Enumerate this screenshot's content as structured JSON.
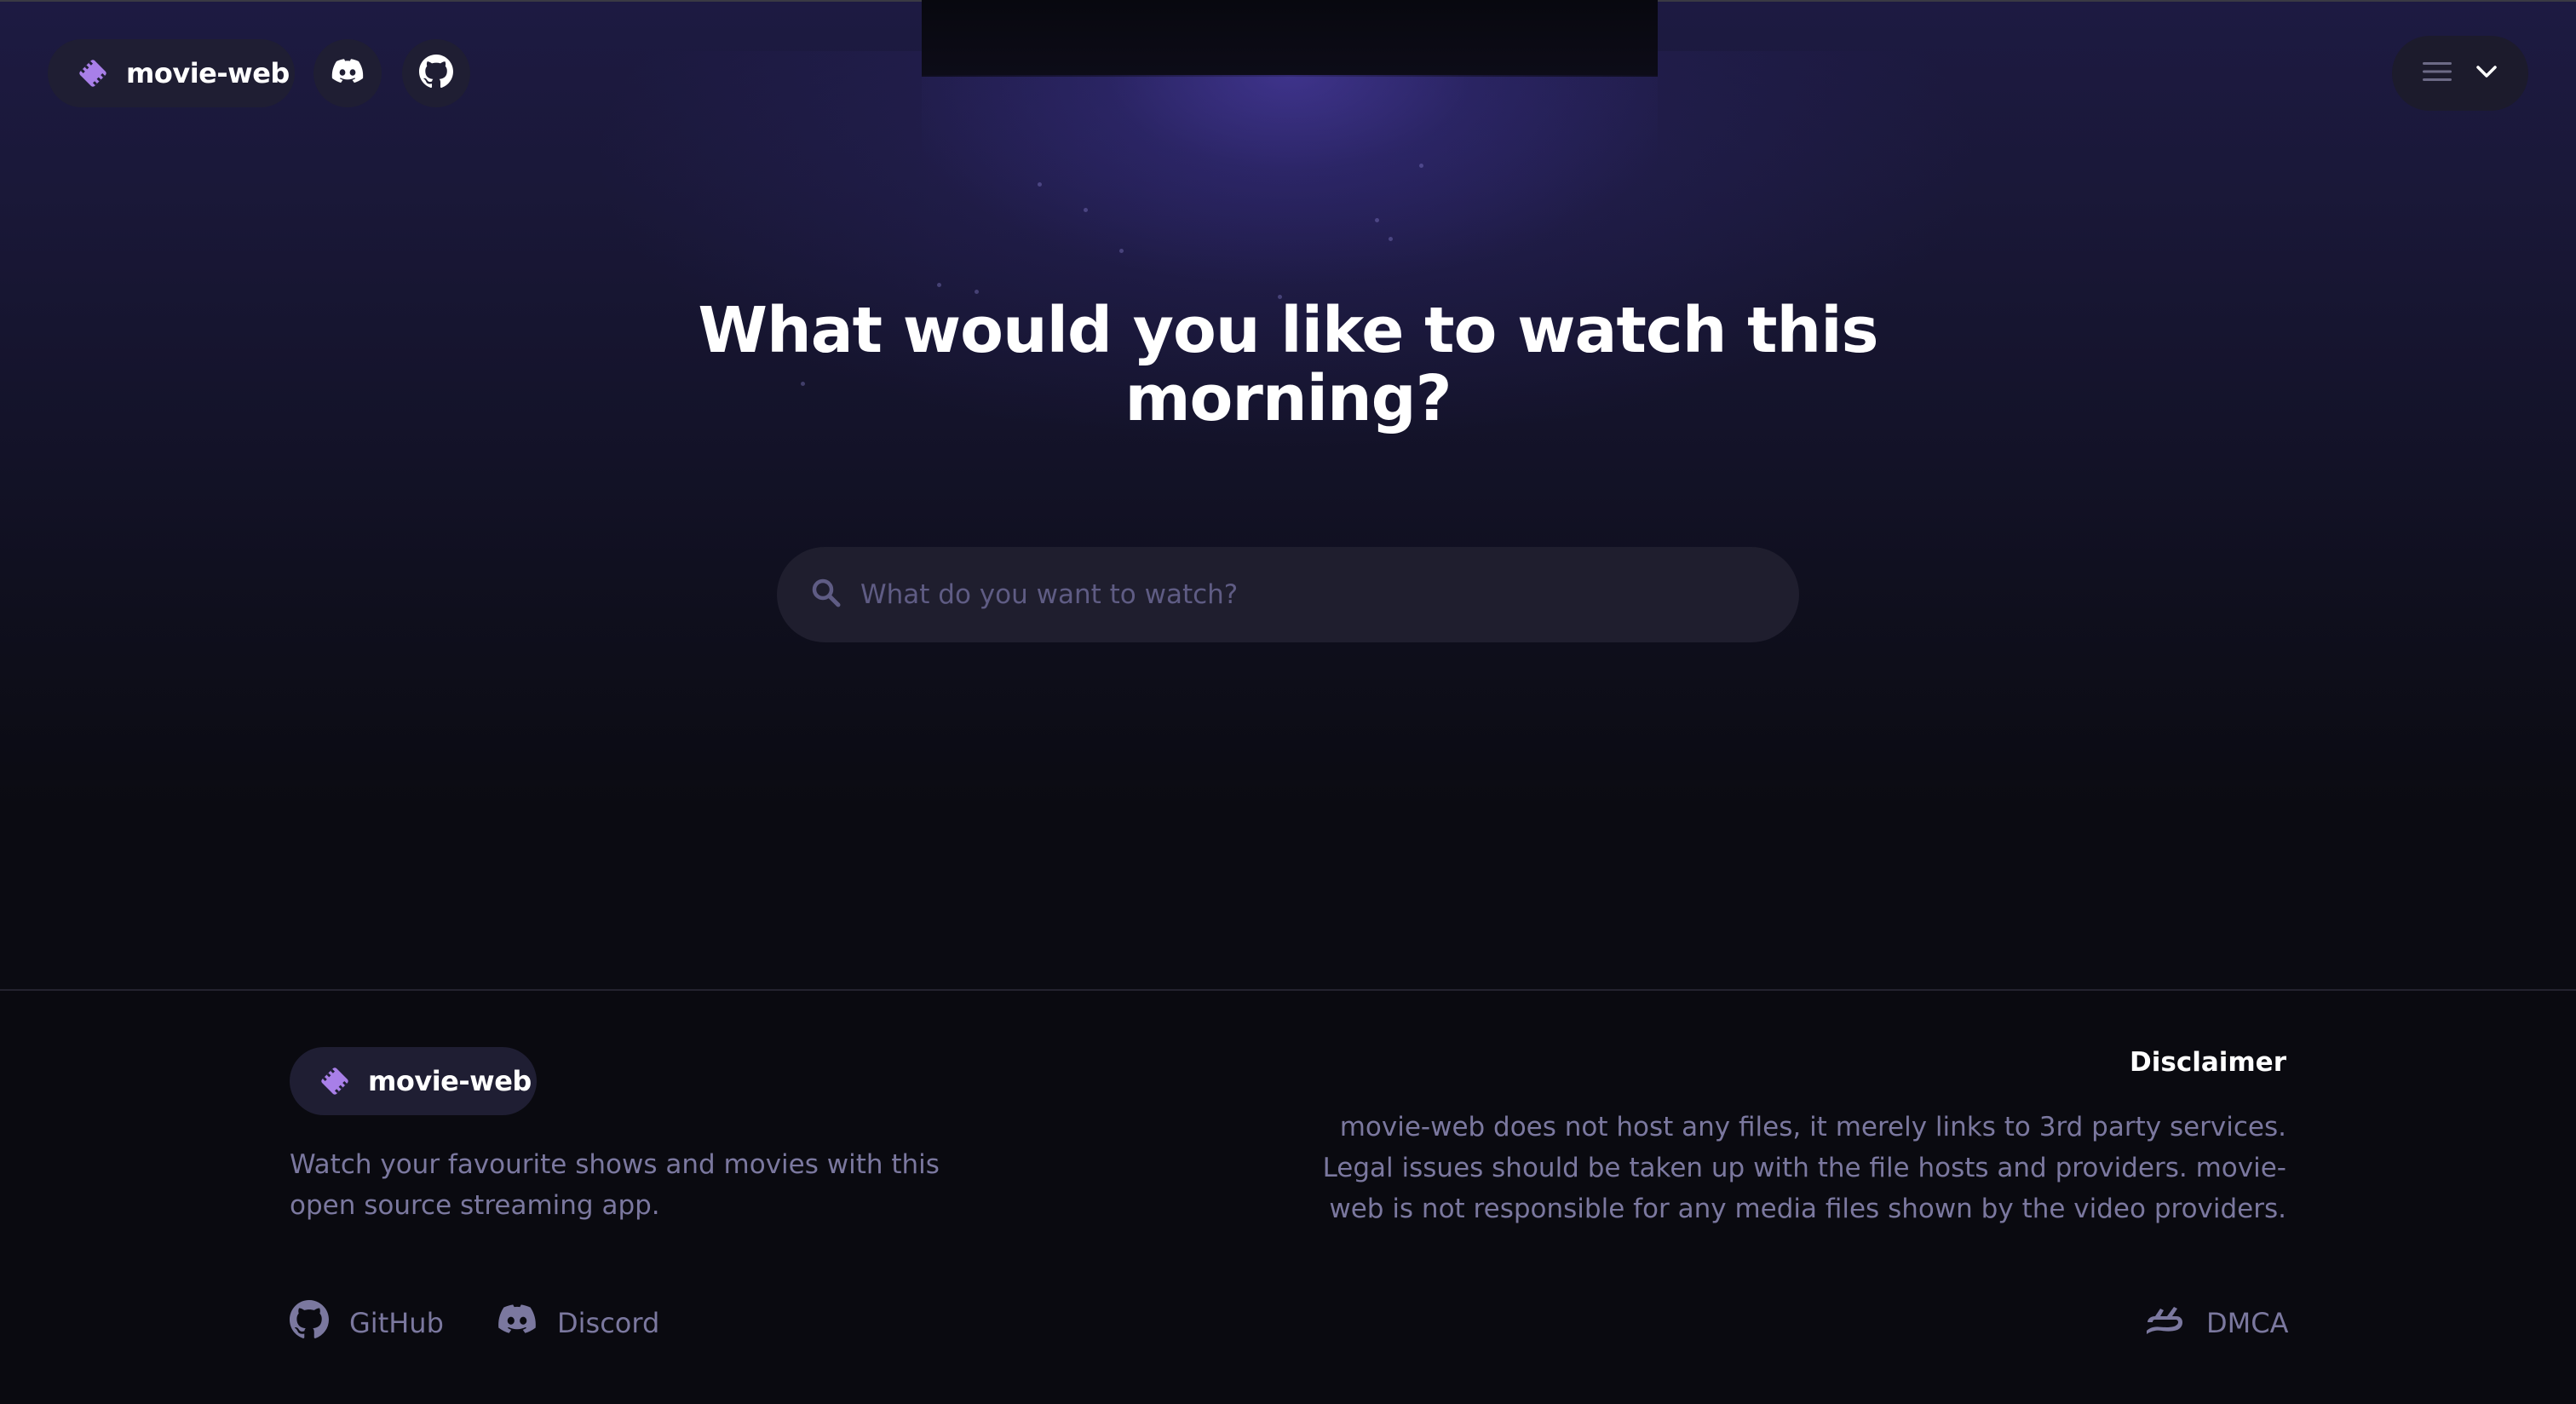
{
  "navbar": {
    "brand": "movie-web",
    "discord_icon": "discord-icon",
    "github_icon": "github-icon",
    "menu_icon": "hamburger-icon",
    "chevron_icon": "chevron-down-icon"
  },
  "hero": {
    "title": "What would you like to watch this morning?"
  },
  "search": {
    "placeholder": "What do you want to watch?",
    "value": "",
    "icon": "search-icon"
  },
  "footer": {
    "brand": "movie-web",
    "tagline": "Watch your favourite shows and movies with this open source streaming app.",
    "disclaimer_title": "Disclaimer",
    "disclaimer_text": "movie-web does not host any files, it merely links to 3rd party services. Legal issues should be taken up with the file hosts and providers. movie-web is not responsible for any media files shown by the video providers.",
    "links": [
      {
        "label": "GitHub",
        "icon": "github-icon"
      },
      {
        "label": "Discord",
        "icon": "discord-icon"
      },
      {
        "label": "DMCA",
        "icon": "dmca-icon"
      }
    ]
  },
  "colors": {
    "accent": "#a87fe8",
    "background": "#0b0b12",
    "pill": "#1f1e33",
    "muted_text": "#7b789f"
  }
}
